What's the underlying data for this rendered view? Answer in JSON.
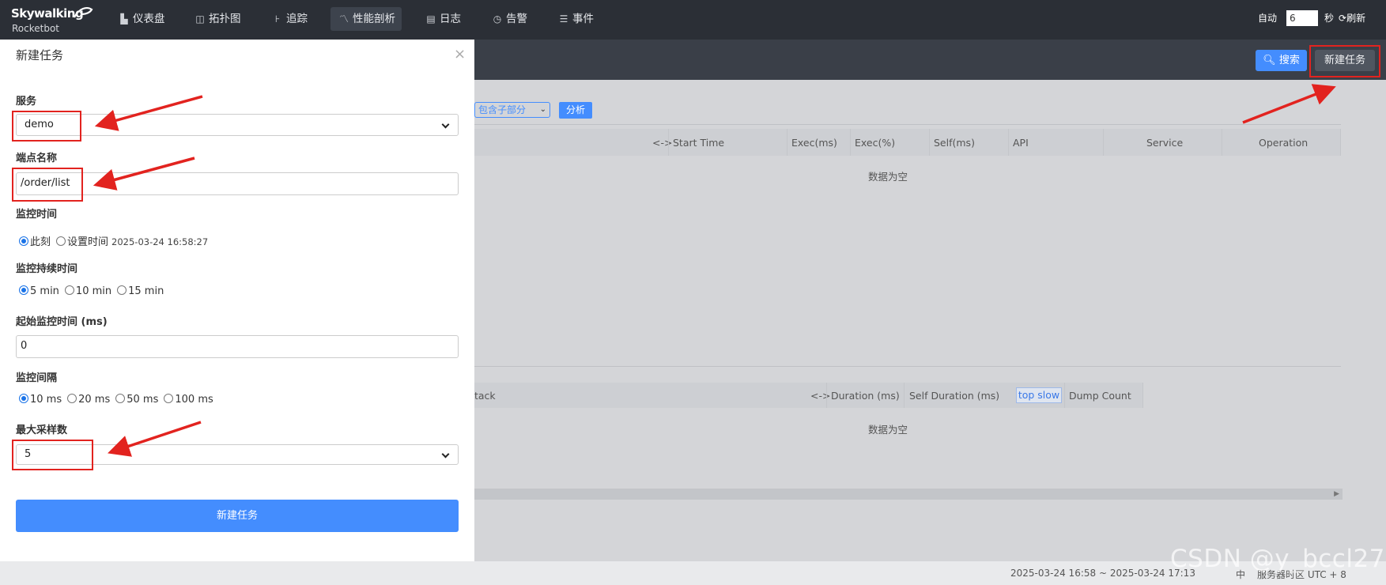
{
  "nav": {
    "logo_top": "Skywalking",
    "logo_bottom": "Rocketbot",
    "items": [
      {
        "label": "仪表盘",
        "icon": "dashboard-icon"
      },
      {
        "label": "拓扑图",
        "icon": "topology-icon"
      },
      {
        "label": "追踪",
        "icon": "trace-icon"
      },
      {
        "label": "性能剖析",
        "icon": "profile-icon",
        "active": true
      },
      {
        "label": "日志",
        "icon": "log-icon"
      },
      {
        "label": "告警",
        "icon": "alarm-icon"
      },
      {
        "label": "事件",
        "icon": "event-icon"
      }
    ],
    "auto_label": "自动",
    "auto_value": "6",
    "seconds_label": "秒",
    "refresh_label": "刷新"
  },
  "toolbar": {
    "search_label": "搜索",
    "new_task_label": "新建任务"
  },
  "profile": {
    "scope_select": "包含子部分",
    "analyze_label": "分析",
    "segment_columns": [
      "<->",
      "Start Time",
      "Exec(ms)",
      "Exec(%)",
      "Self(ms)",
      "API",
      "Service",
      "Operation"
    ],
    "segment_empty": "数据为空",
    "stack_columns": [
      "tack",
      "<->",
      "Duration (ms)",
      "Self Duration (ms)",
      "top slow",
      "Dump Count"
    ],
    "stack_empty": "数据为空"
  },
  "modal": {
    "title": "新建任务",
    "close": "×",
    "service_label": "服务",
    "service_value": "demo",
    "endpoint_label": "端点名称",
    "endpoint_value": "/order/list",
    "monitor_time_label": "监控时间",
    "monitor_time_options": [
      "此刻",
      "设置时间"
    ],
    "monitor_time_value": "2025-03-24 16:58:27",
    "duration_label": "监控持续时间",
    "duration_options": [
      "5 min",
      "10 min",
      "15 min"
    ],
    "start_label": "起始监控时间 (ms)",
    "start_value": "0",
    "interval_label": "监控间隔",
    "interval_options": [
      "10 ms",
      "20 ms",
      "50 ms",
      "100 ms"
    ],
    "max_sample_label": "最大采样数",
    "max_sample_value": "5",
    "submit_label": "新建任务"
  },
  "footer": {
    "time_range": "2025-03-24 16:58 ~ 2025-03-24 17:13",
    "lang": "中",
    "timezone": "服务器时区 UTC + 8"
  },
  "watermark": "CSDN @y_bccl27",
  "colors": {
    "nav_bg": "#2b2f36",
    "accent": "#448dfe",
    "annotation": "#e2231f"
  }
}
